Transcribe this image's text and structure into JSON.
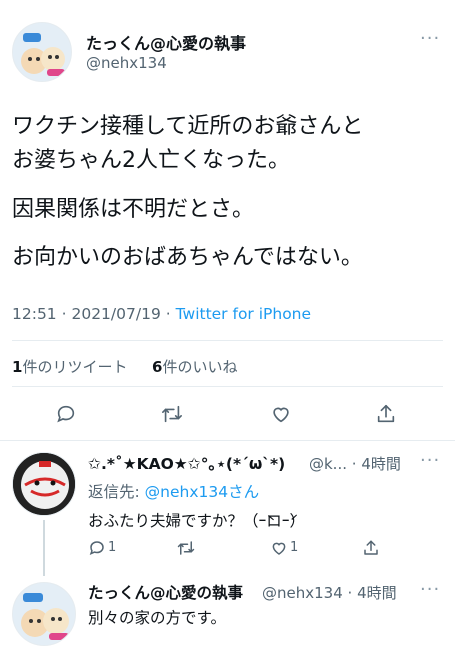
{
  "main_tweet": {
    "display_name": "たっくん@心愛の執事",
    "handle": "@nehx134",
    "more": "···",
    "text_lines": [
      "ワクチン接種して近所のお爺さんと",
      "お婆ちゃん2人亡くなった。",
      "因果関係は不明だとさ。",
      "お向かいのおばあちゃんではない。"
    ],
    "time": "12:51",
    "date": "2021/07/19",
    "source": "Twitter for iPhone",
    "retweets_count": "1",
    "retweets_label": "件のリツイート",
    "likes_count": "6",
    "likes_label": "件のいいね"
  },
  "reply1": {
    "display_name": "✩.*˚★KAO★✩°｡⋆(*´ω`*)",
    "handle": "@k...",
    "time": "4時間",
    "more": "···",
    "reply_to_label": "返信先: ",
    "reply_to_handle": "@nehx134さん",
    "text": "おふたり夫婦ですか？（ｰ̀ロｰ́）",
    "reply_count": "1",
    "like_count": "1"
  },
  "reply2": {
    "display_name": "たっくん@心愛の執事",
    "handle": "@nehx134",
    "time": "4時間",
    "more": "···",
    "text": "別々の家の方です。"
  },
  "icons": {
    "reply": "reply-icon",
    "retweet": "retweet-icon",
    "like": "heart-icon",
    "share": "share-icon"
  },
  "colors": {
    "link": "#1d9bf0",
    "secondary": "#536471",
    "divider": "#e6ecf0"
  }
}
